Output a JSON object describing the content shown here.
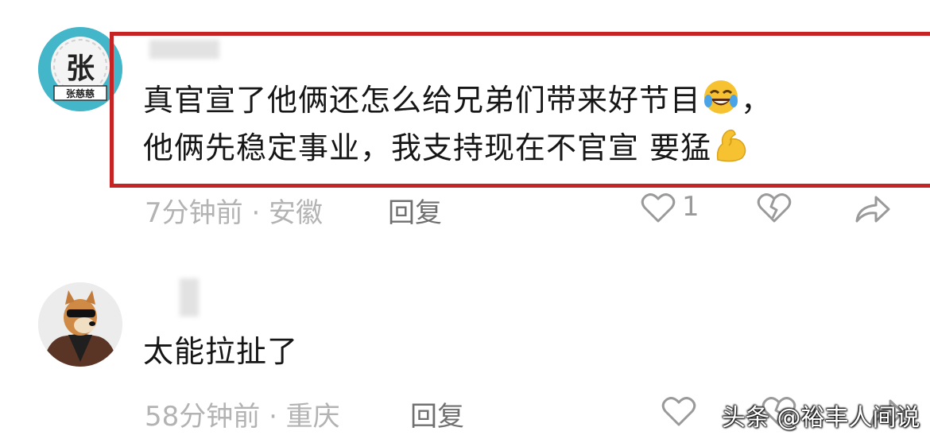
{
  "comments": [
    {
      "avatar_text": "张",
      "avatar_caption": "张慈慈",
      "text_line1": "真官宣了他俩还怎么给兄弟们带来好节目",
      "text_line1_tail": "，",
      "text_line2": "他俩先稳定事业，我支持现在不官宣  要猛",
      "emoji1": "rolling-laughing-emoji",
      "emoji2": "flexed-biceps-emoji",
      "meta": "7分钟前 · 安徽",
      "reply_label": "回复",
      "like_count": "1",
      "highlight_color": "#c62324"
    },
    {
      "text_line1": "太能拉扯了",
      "meta": "58分钟前 · 重庆",
      "reply_label": "回复",
      "like_count": ""
    }
  ],
  "icons": [
    "heart-icon",
    "broken-heart-icon",
    "share-icon"
  ],
  "watermark": "头条 @裕丰人间说"
}
